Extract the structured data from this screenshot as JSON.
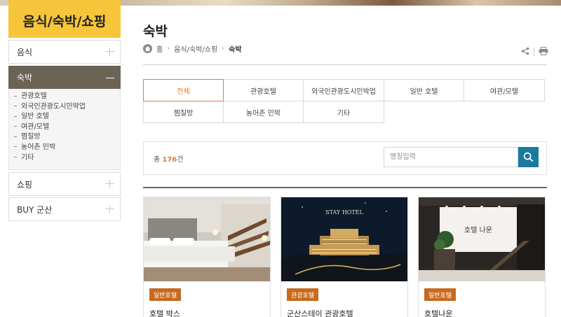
{
  "sidebar": {
    "title": "음식/숙박/쇼핑",
    "items": [
      {
        "label": "음식"
      },
      {
        "label": "숙박"
      },
      {
        "label": "쇼핑"
      },
      {
        "label": "BUY 군산"
      }
    ],
    "submenu": [
      "관광호텔",
      "외국인관광도시민박업",
      "일반 호텔",
      "여관/모텔",
      "찜질방",
      "농어촌 민박",
      "기타"
    ]
  },
  "page": {
    "title": "숙박",
    "breadcrumb": [
      "홈",
      "음식/숙박/쇼핑",
      "숙박"
    ]
  },
  "tabs": [
    "전체",
    "관광호텔",
    "외국인관광도시민박업",
    "일반 호텔",
    "여관/모텔",
    "찜질방",
    "농어촌 민박",
    "기타"
  ],
  "search": {
    "total_prefix": "총 ",
    "total_count": "176",
    "total_suffix": "건",
    "placeholder": "명칭입력"
  },
  "cards": [
    {
      "category": "일반호텔",
      "name": "호텔 박스"
    },
    {
      "category": "관광호텔",
      "name": "군산스테이 관광호텔",
      "sign": "STAY HOTEL"
    },
    {
      "category": "일반호텔",
      "name": "호텔나운",
      "sign": "호텔 나운"
    }
  ],
  "colors": {
    "accent": "#e0803c",
    "sidebar_title_bg": "#f6c53a",
    "sidebar_active_bg": "#6b6356",
    "search_button": "#1a7a9e",
    "badge": "#c86a1e"
  }
}
